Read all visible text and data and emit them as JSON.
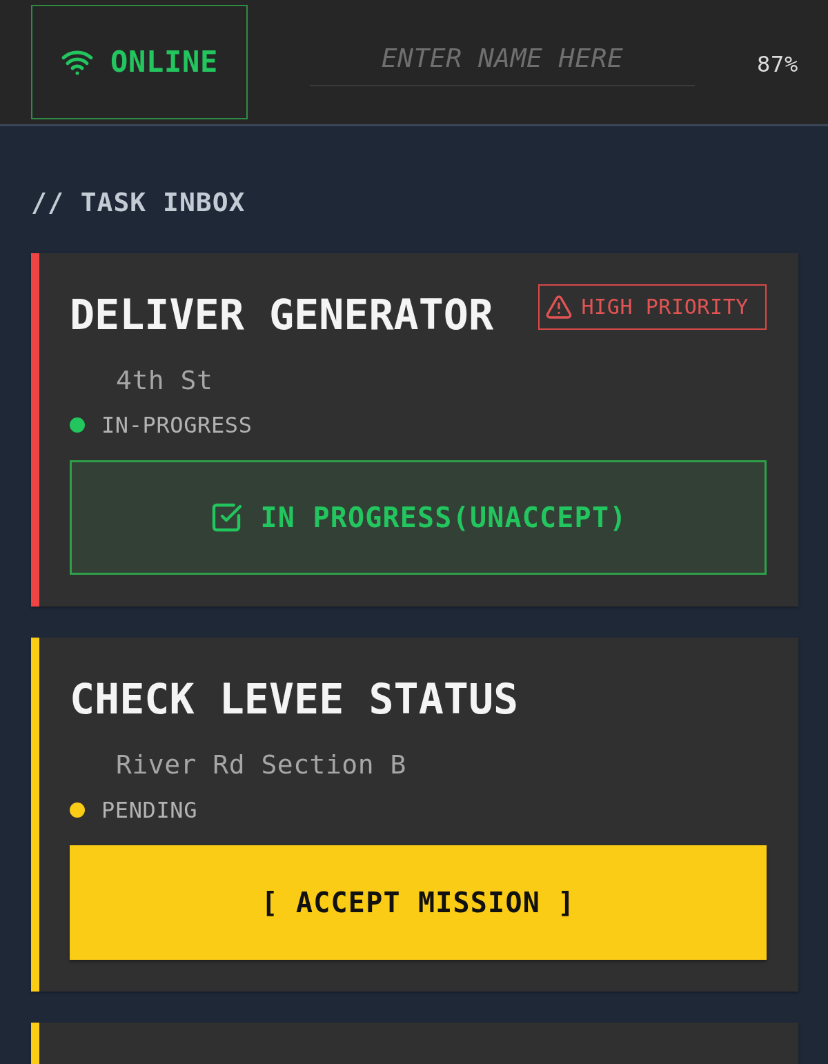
{
  "header": {
    "connection": "ONLINE",
    "name_field": {
      "placeholder": "ENTER NAME HERE"
    },
    "battery": "87%"
  },
  "section_title": "// TASK INBOX",
  "tasks": [
    {
      "color": "#ef4444",
      "title": "DELIVER GENERATOR",
      "badge": "HIGH PRIORITY",
      "address": "4th St",
      "status": {
        "label": "IN-PROGRESS",
        "color": "#22c55e"
      },
      "action": {
        "kind": "progress",
        "label": "IN PROGRESS(UNACCEPT)"
      }
    },
    {
      "color": "#facc15",
      "title": "CHECK LEVEE STATUS",
      "address": "River Rd Section B",
      "status": {
        "label": "PENDING",
        "color": "#facc15"
      },
      "action": {
        "kind": "accept",
        "label": "[ ACCEPT MISSION ]"
      }
    },
    {
      "color": "#facc15"
    }
  ]
}
